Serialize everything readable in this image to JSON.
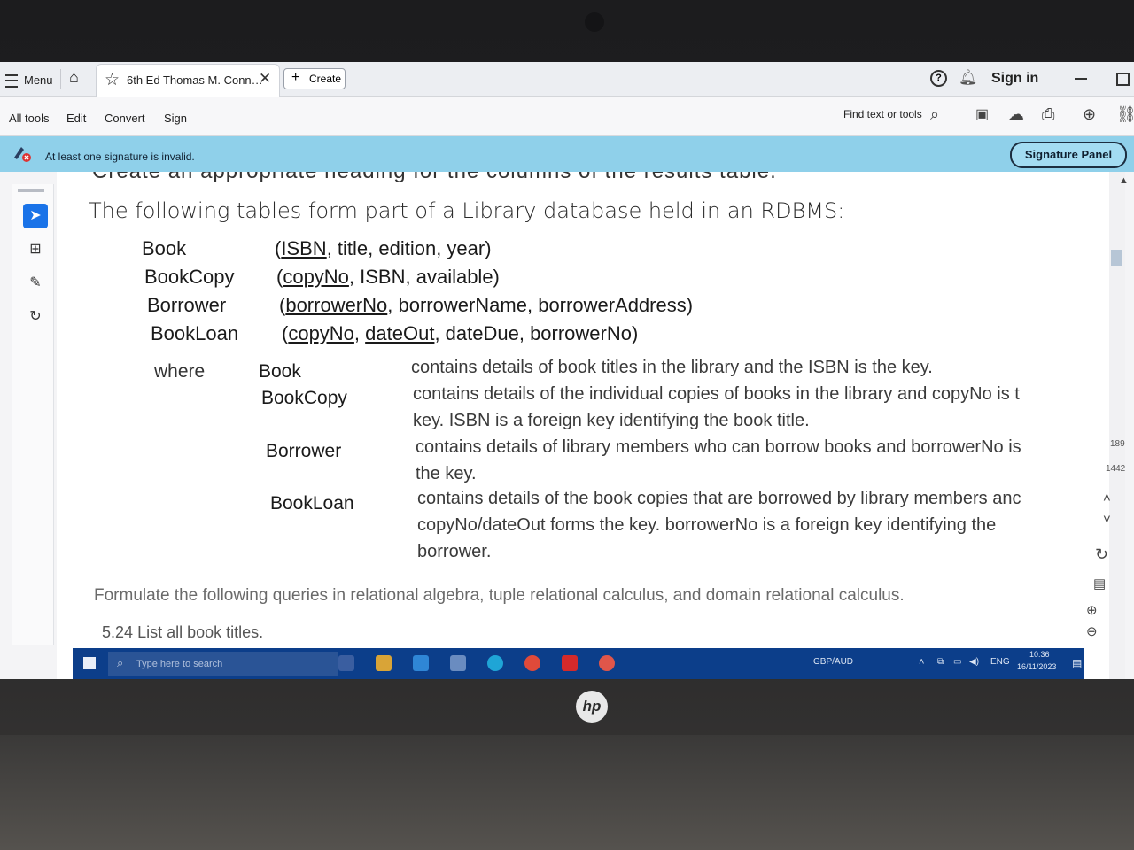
{
  "tabbar": {
    "menu_label": "Menu",
    "tab_title": "6th Ed Thomas M. Conn…",
    "create_label": "Create",
    "signin_label": "Sign in"
  },
  "toolbar": {
    "items": [
      "All tools",
      "Edit",
      "Convert",
      "Sign"
    ],
    "find_label": "Find text or tools"
  },
  "banner": {
    "message": "At least one signature is invalid.",
    "panel_button": "Signature Panel"
  },
  "document": {
    "cut_text": "Create an appropriate heading for the columns of the results table.",
    "intro": "The following tables form part of a Library database held in an RDBMS:",
    "relations": [
      {
        "name": "Book",
        "open": "(",
        "key": [
          "ISBN"
        ],
        "rest": ", title, edition, year)"
      },
      {
        "name": "BookCopy",
        "open": "(",
        "key": [
          "copyNo"
        ],
        "rest": ", ISBN, available)"
      },
      {
        "name": "Borrower",
        "open": "(",
        "key": [
          "borrowerNo"
        ],
        "rest": ", borrowerName, borrowerAddress)"
      },
      {
        "name": "BookLoan",
        "open": "(",
        "key": [
          "copyNo",
          "dateOut"
        ],
        "rest": ", dateDue, borrowerNo)"
      }
    ],
    "where_label": "where",
    "descriptions": [
      {
        "name": "Book",
        "lines": [
          "contains details of book titles in the library and the ISBN is the key."
        ]
      },
      {
        "name": "BookCopy",
        "lines": [
          "contains details of the individual copies of books in the library and copyNo is t",
          "key. ISBN is a foreign key identifying the book title."
        ]
      },
      {
        "name": "Borrower",
        "lines": [
          "contains details of library members who can borrow books and borrowerNo is",
          "the key."
        ]
      },
      {
        "name": "BookLoan",
        "lines": [
          "contains details of the book copies that are borrowed by library members anc",
          "copyNo/dateOut forms the key. borrowerNo is a foreign key identifying the",
          "borrower."
        ]
      }
    ],
    "formulate": "Formulate the following queries in relational algebra, tuple relational calculus, and domain relational calculus.",
    "query_number": "5.24",
    "query_text": "List all book titles."
  },
  "right_rail": {
    "page_current": "189",
    "page_total": "1442"
  },
  "taskbar": {
    "search_placeholder": "Type here to search",
    "ticker": "GBP/AUD",
    "language": "ENG",
    "time": "10:36",
    "date": "16/11/2023"
  }
}
